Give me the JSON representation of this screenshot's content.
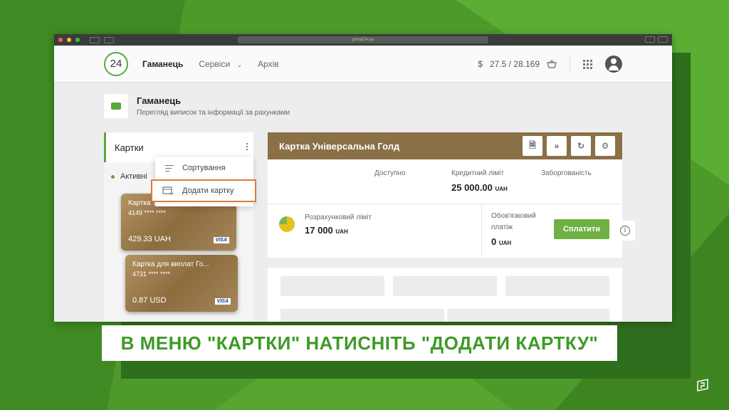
{
  "browser": {
    "url": "privat24.ua"
  },
  "nav": {
    "logo": "24",
    "items": [
      "Гаманець",
      "Сервіси",
      "Архів"
    ],
    "rates_currency": "$",
    "rates": "27.5 / 28.169"
  },
  "page_header": {
    "title": "Гаманець",
    "subtitle": "Перегляд виписок та інформації за рахунками"
  },
  "cards_panel": {
    "title": "Картки",
    "active_label": "Активні",
    "cards": [
      {
        "name": "Картка Універсальна Голд",
        "number": "4149 **** ****",
        "amount": "429.33 UAH",
        "brand": "VISA"
      },
      {
        "name": "Картка для виплат Го...",
        "number": "4731 **** ****",
        "amount": "0.87 USD",
        "brand": "VISA"
      }
    ]
  },
  "dropdown": {
    "items": [
      "Сортування",
      "Додати картку"
    ]
  },
  "card_detail": {
    "title": "Картка Універсальна Голд",
    "available_label": "Доступно",
    "credit_limit_label": "Кредитний ліміт",
    "credit_limit_value": "25 000.00",
    "credit_limit_currency": "UAH",
    "debt_label": "Заборгованість",
    "settlement_label": "Розрахунковий ліміт",
    "settlement_value": "17 000",
    "settlement_currency": "UAH",
    "mandatory_label_1": "Обов'язковий",
    "mandatory_label_2": "платіж",
    "mandatory_value": "0",
    "mandatory_currency": "UAH",
    "pay_button": "Сплатити"
  },
  "caption": "В МЕНЮ \"КАРТКИ\" НАТИСНІТЬ \"ДОДАТИ КАРТКУ\"",
  "colors": {
    "brand_green": "#5aa83b",
    "card_header_brown": "#8b6f47",
    "highlight_orange": "#e07b3a"
  }
}
